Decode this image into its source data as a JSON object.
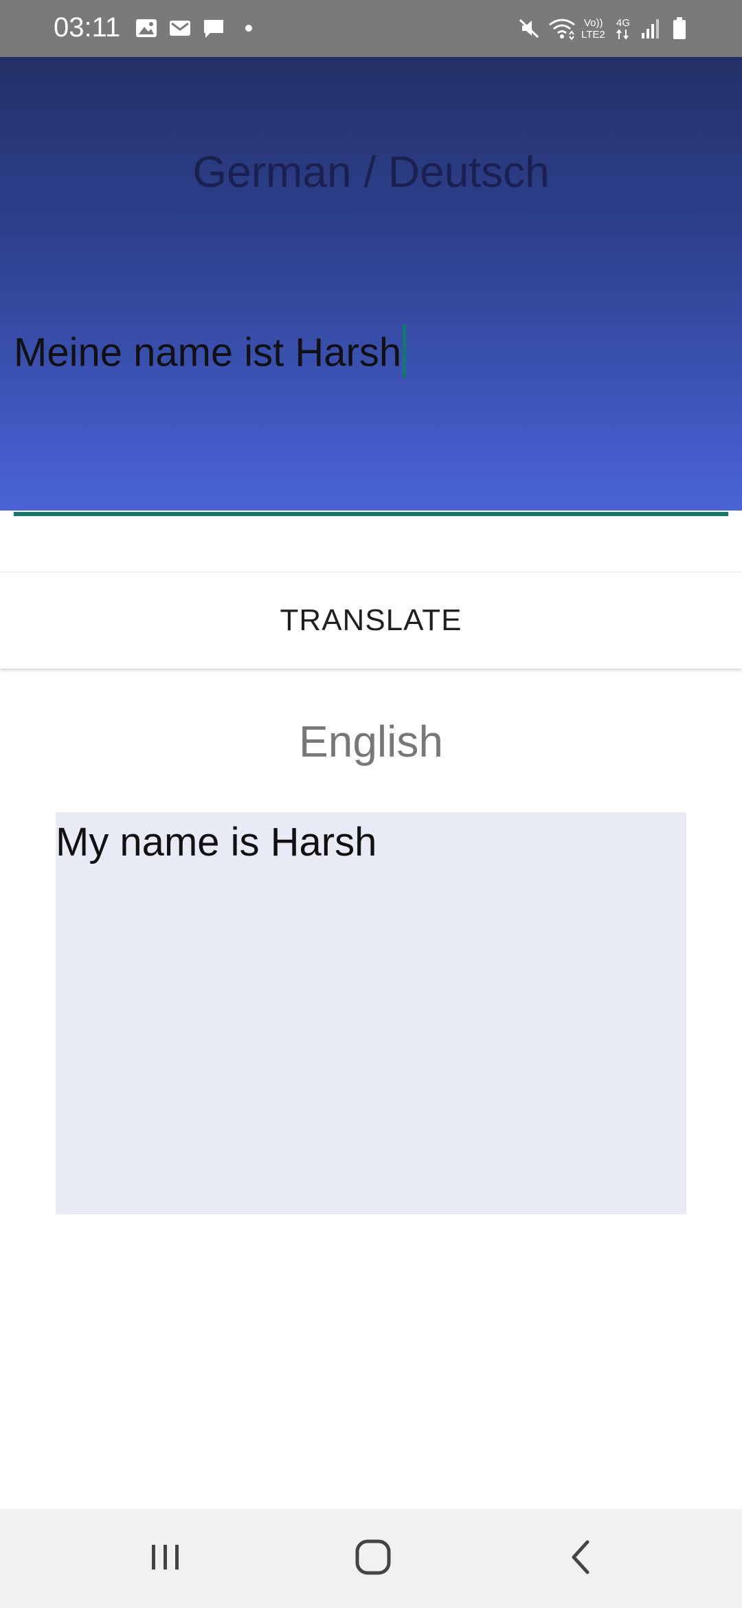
{
  "status_bar": {
    "time": "03:11",
    "icons": [
      "image-icon",
      "gmail-icon",
      "message-icon",
      "dot-icon",
      "mute-icon",
      "wifi-icon",
      "volte-icon",
      "4g-icon",
      "signal-icon",
      "battery-icon"
    ],
    "volte_top": "Vo))",
    "volte_bottom": "LTE2",
    "network_type": "4G"
  },
  "source": {
    "language_title": "German / Deutsch",
    "input_value": "Meine name ist Harsh"
  },
  "translate_button": {
    "label": "TRANSLATE"
  },
  "target": {
    "language_title": "English",
    "output_value": "My name is Harsh"
  },
  "nav_bar": {
    "icons": [
      "recent-apps-icon",
      "home-icon",
      "back-icon"
    ]
  },
  "colors": {
    "status_bar": "#7a7a7a",
    "gradient_top": "#233068",
    "gradient_bottom": "#4a64d8",
    "accent_teal": "#0f7a6b",
    "output_box": "#e8eaf6",
    "nav_bar": "#f1f1f1"
  }
}
